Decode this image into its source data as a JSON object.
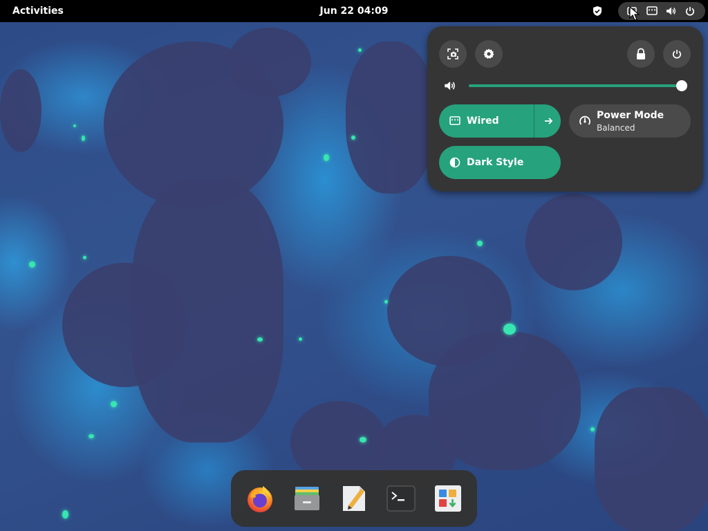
{
  "topbar": {
    "activities": "Activities",
    "clock": "Jun 22  04:09",
    "status_icons": [
      "shield-icon",
      "network-wired-icon",
      "volume-icon",
      "power-icon"
    ]
  },
  "quick_settings": {
    "buttons": [
      "screenshot-icon",
      "settings-icon",
      "lock-icon",
      "power-icon"
    ],
    "volume": {
      "icon": "volume-icon",
      "level": 1.0
    },
    "toggles": {
      "wired": {
        "label": "Wired",
        "state": "on",
        "icon": "network-wired-icon"
      },
      "power_mode": {
        "label": "Power Mode",
        "subtitle": "Balanced",
        "state": "off",
        "icon": "power-profile-icon"
      },
      "dark_style": {
        "label": "Dark Style",
        "state": "on",
        "icon": "dark-style-icon"
      }
    },
    "accent_color": "#26a27c"
  },
  "dock": {
    "apps": [
      "firefox-icon",
      "files-icon",
      "text-editor-icon",
      "terminal-icon",
      "software-icon"
    ]
  }
}
